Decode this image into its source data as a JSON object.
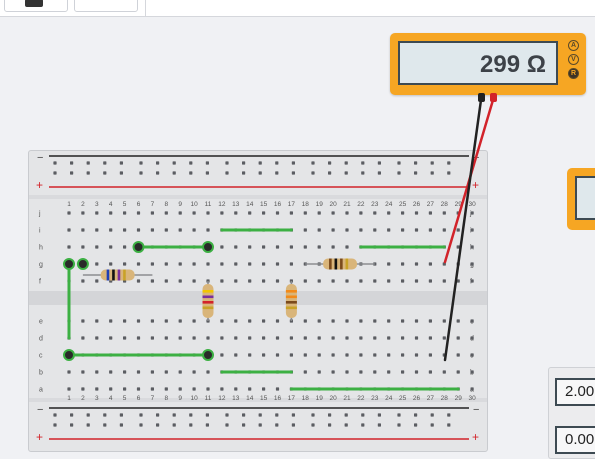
{
  "multimeter": {
    "reading": "299 Ω",
    "modes": [
      "A",
      "V",
      "R"
    ],
    "active_mode": "R",
    "colors": {
      "body": "#f6a623",
      "display": "#dfe8ec"
    }
  },
  "breadboard": {
    "row_letters_top": [
      "j",
      "i",
      "h",
      "g",
      "f"
    ],
    "row_letters_bottom": [
      "e",
      "d",
      "c",
      "b",
      "a"
    ],
    "rail_minus": "−",
    "rail_plus": "+",
    "column_count": 30,
    "colors": {
      "wire": "#3cb043",
      "rail_minus": "#222222",
      "rail_plus": "#d2232a"
    }
  },
  "components": {
    "resistors": [
      {
        "id": "r1",
        "orientation": "horizontal",
        "bands": [
          "#1f3fb5",
          "#111111",
          "#7a2f9c",
          "#c9a227"
        ]
      },
      {
        "id": "r2",
        "orientation": "vertical",
        "bands": [
          "#f2c500",
          "#7a2f9c",
          "#d2232a",
          "#c9a227"
        ]
      },
      {
        "id": "r3",
        "orientation": "vertical",
        "bands": [
          "#f28a1a",
          "#f28a1a",
          "#7a4a1c",
          "#c9a227"
        ]
      },
      {
        "id": "r4",
        "orientation": "horizontal",
        "bands": [
          "#7a4a1c",
          "#111111",
          "#7a4a1c",
          "#c9a227"
        ]
      }
    ]
  },
  "side_panel": {
    "field_1": "2.00",
    "field_2": "0.00"
  }
}
